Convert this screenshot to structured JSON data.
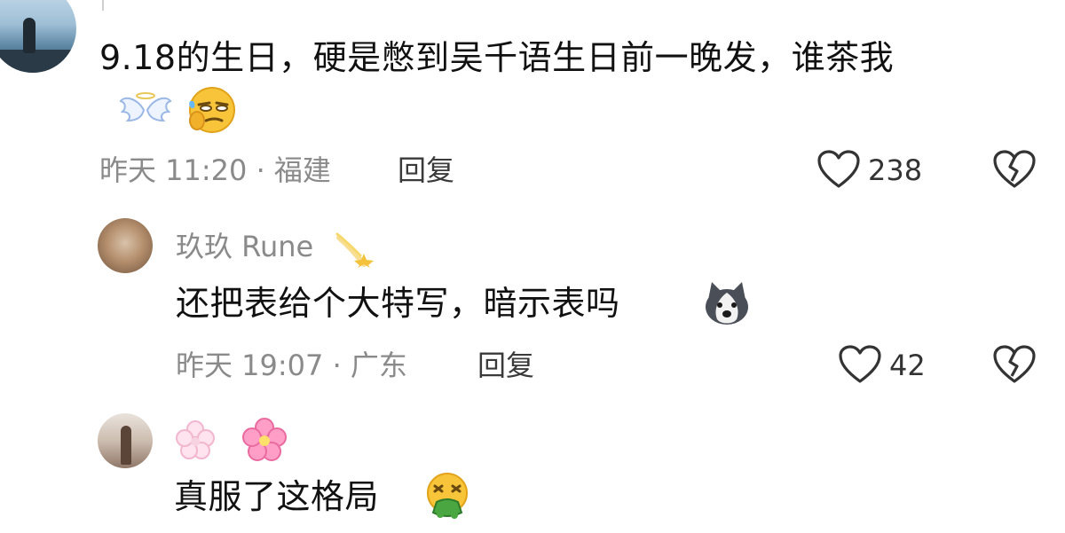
{
  "comments": [
    {
      "text": "9.18的生日，硬是憋到吴千语生日前一晚发，谁茶我",
      "emojis": [
        "angel-wings-icon",
        "smirk-face-icon"
      ],
      "meta": "昨天 11:20 · 福建",
      "reply_label": "回复",
      "likes": "238"
    },
    {
      "username": "玖玖 Rune",
      "username_emoji": "shooting-star-icon",
      "text": "还把表给个大特写，暗示表吗",
      "emoji": "husky-face-icon",
      "meta": "昨天 19:07 · 广东",
      "reply_label": "回复",
      "likes": "42"
    },
    {
      "username_emojis": [
        "blossom-icon",
        "cherry-blossom-icon"
      ],
      "text": "真服了这格局",
      "emoji": "vomiting-face-icon"
    }
  ],
  "colors": {
    "text": "#111111",
    "meta": "#8a8a8a",
    "icon": "#333333"
  }
}
